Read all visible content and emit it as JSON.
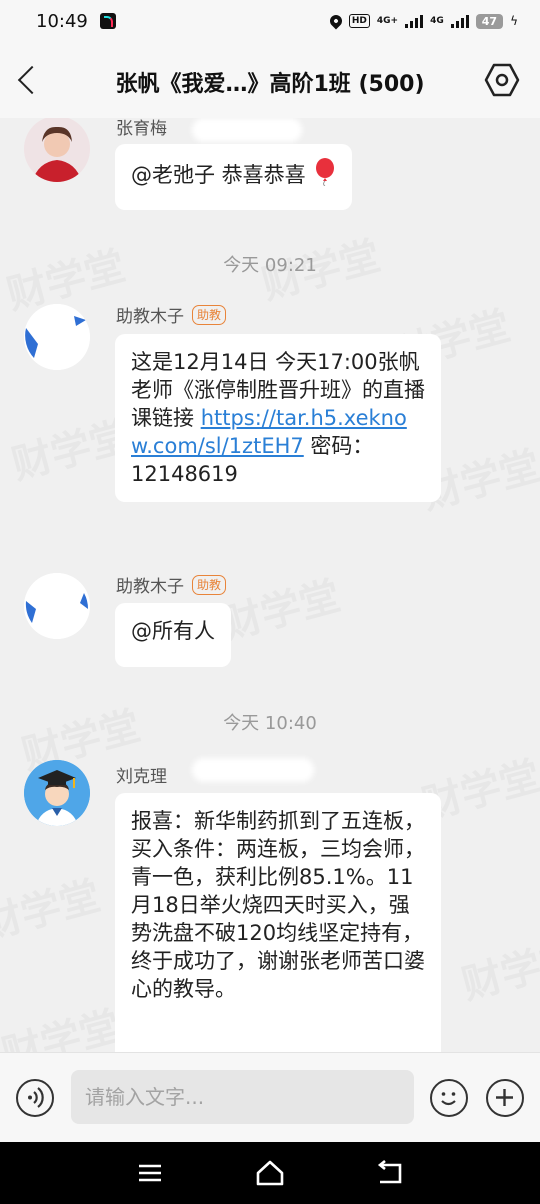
{
  "status_bar": {
    "time": "10:49",
    "hd_label": "HD",
    "net1": "4G+",
    "net2": "4G",
    "battery": "47"
  },
  "header": {
    "title": "张帆《我爱…》高阶1班 (500)"
  },
  "watermark": "财学堂",
  "messages": [
    {
      "sender": "张育梅",
      "text": "@老弛子 恭喜恭喜"
    },
    {
      "timestamp": "今天 09:21"
    },
    {
      "sender": "助教木子",
      "role_tag": "助教",
      "text_before": "这是12月14日 今天17:00张帆老师《涨停制胜晋升班》的直播课链接",
      "link": "https://tar.h5.xeknow.com/sl/1ztEH7",
      "text_after": " 密码：12148619"
    },
    {
      "sender": "助教木子",
      "role_tag": "助教",
      "text": "@所有人"
    },
    {
      "timestamp": "今天 10:40"
    },
    {
      "sender": "刘克理",
      "text": "报喜：新华制药抓到了五连板，买入条件：两连板，三均会师，青一色，获利比例85.1%。11月18日举火烧四天时买入，强势洗盘不破120均线坚定持有，终于成功了，谢谢张老师苦口婆心的教导。"
    }
  ],
  "input_bar": {
    "placeholder": "请输入文字..."
  },
  "colors": {
    "link": "#2a7fd6",
    "tag": "#e8843a",
    "background": "#f0f0f0"
  }
}
